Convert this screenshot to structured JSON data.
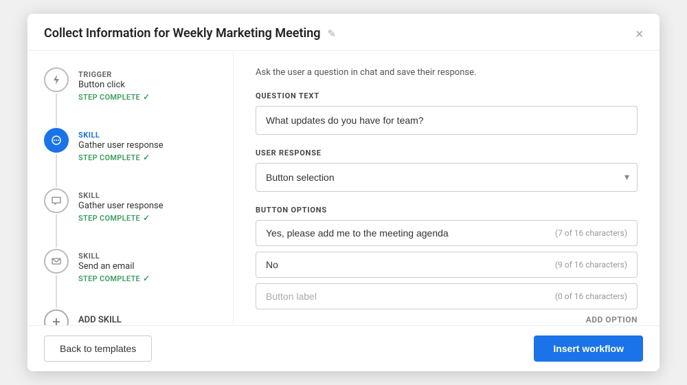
{
  "modal": {
    "title": "Collect Information for Weekly Marketing Meeting",
    "edit_icon": "✎",
    "close_icon": "×"
  },
  "sidebar": {
    "steps": [
      {
        "type": "TRIGGER",
        "description": "Button click",
        "status": "STEP COMPLETE",
        "active": false,
        "icon": "bolt"
      },
      {
        "type": "SKILL",
        "description": "Gather user response",
        "status": "STEP COMPLETE",
        "active": true,
        "icon": "chat-active"
      },
      {
        "type": "SKILL",
        "description": "Gather user response",
        "status": "STEP COMPLETE",
        "active": false,
        "icon": "chat"
      },
      {
        "type": "SKILL",
        "description": "Send an email",
        "status": "STEP COMPLETE",
        "active": false,
        "icon": "email"
      }
    ],
    "add_skill_label": "ADD SKILL"
  },
  "main": {
    "subtitle": "Ask the user a question in chat and save their response.",
    "question_label": "QUESTION TEXT",
    "question_value": "What updates do you have for team?",
    "response_label": "USER RESPONSE",
    "response_placeholder": "Button selection",
    "response_options": [
      "Button selection"
    ],
    "button_options_label": "BUTTON OPTIONS",
    "button_options": [
      {
        "value": "Yes, please add me to the meeting agenda",
        "chars": "7 of 16 characters"
      },
      {
        "value": "No",
        "chars": "9 of 16 characters"
      }
    ],
    "button_option_placeholder": "Button label",
    "button_option_placeholder_chars": "0 of 16 characters",
    "add_option_label": "ADD OPTION"
  },
  "footer": {
    "back_label": "Back to templates",
    "insert_label": "Insert workflow"
  }
}
